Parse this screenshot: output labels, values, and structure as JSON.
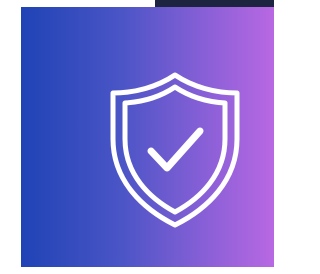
{
  "colors": {
    "top_bar": "#1d2440",
    "gradient_start": "#1f43b5",
    "gradient_end": "#b868e2",
    "shield_stroke": "#ffffff"
  },
  "icon": {
    "name": "shield-check-icon"
  }
}
